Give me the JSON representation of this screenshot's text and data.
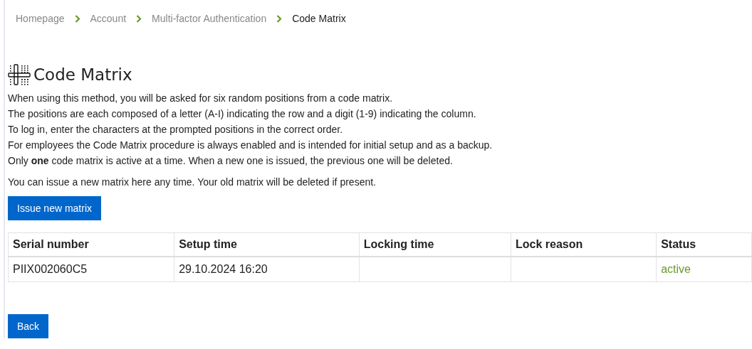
{
  "breadcrumb": [
    {
      "label": "Homepage",
      "current": false
    },
    {
      "label": "Account",
      "current": false
    },
    {
      "label": "Multi-factor Authentication",
      "current": false
    },
    {
      "label": "Code Matrix",
      "current": true
    }
  ],
  "title": "Code Matrix",
  "intro": [
    "When using this method, you will be asked for six random positions from a code matrix.",
    "The positions are each composed of a letter (A-I) indicating the row and a digit (1-9) indicating the column.",
    "To log in, enter the characters at the prompted positions in the correct order.",
    "For employees the Code Matrix procedure is always enabled and is intended for initial setup and as a backup.",
    "Only **one** code matrix is active at a time. When a new one is issued, the previous one will be deleted."
  ],
  "issue_note": "You can issue a new matrix here any time. Your old matrix will be deleted if present.",
  "issue_button": "Issue new matrix",
  "table": {
    "columns": [
      "Serial number",
      "Setup time",
      "Locking time",
      "Lock reason",
      "Status"
    ],
    "rows": [
      {
        "serial": "PIIX002060C5",
        "setup_time": "29.10.2024 16:20",
        "status": "active"
      }
    ]
  },
  "back_button": "Back"
}
